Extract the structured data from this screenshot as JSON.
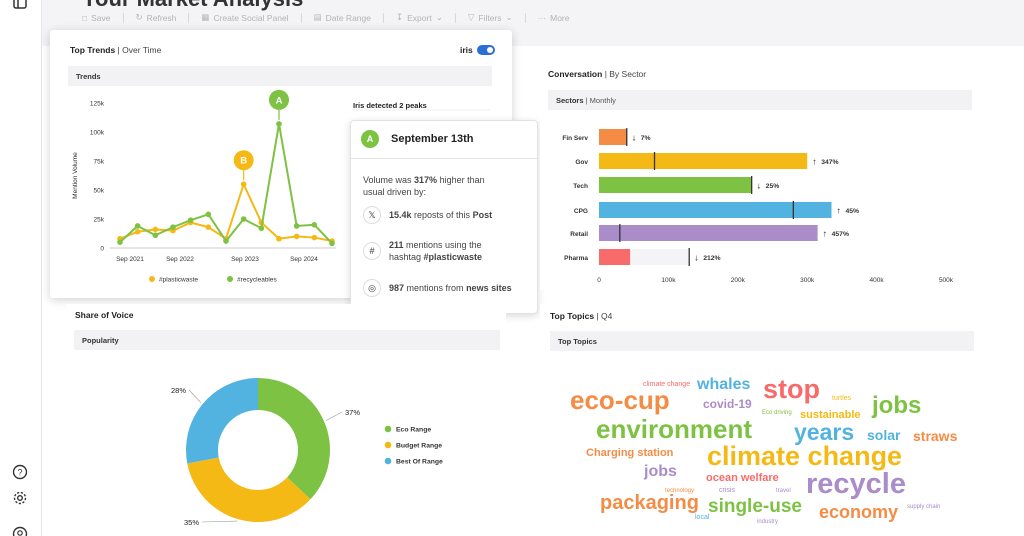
{
  "page": {
    "title": "Your Market Analysis"
  },
  "toolbar": {
    "items": [
      "Save",
      "Refresh",
      "Create Social Panel",
      "Date Range",
      "Export",
      "Filters",
      "More"
    ]
  },
  "trends": {
    "title": "Top Trends",
    "subtitle": "Over Time",
    "iris_label": "iris",
    "iris_on": true,
    "subbar": "Trends",
    "peaks_note": "Iris detected 2 peaks",
    "chart_data": {
      "type": "line",
      "ylabel": "Mention Volume",
      "yticks": [
        "0",
        "25k",
        "50k",
        "75k",
        "100k",
        "125k"
      ],
      "xticks": [
        "Sep 2021",
        "Sep 2022",
        "Sep 2023",
        "Sep 2024"
      ],
      "ylim": [
        0,
        125000
      ],
      "series": [
        {
          "name": "#plasticwaste",
          "color": "#f5b916",
          "values": [
            8000,
            14000,
            16000,
            15000,
            22000,
            18000,
            8000,
            55000,
            22000,
            8000,
            10000,
            9000,
            6000
          ]
        },
        {
          "name": "#recycleables",
          "color": "#7dc242",
          "values": [
            5000,
            19000,
            11000,
            18000,
            24000,
            29000,
            6000,
            25000,
            17000,
            107000,
            19000,
            20000,
            4000
          ]
        }
      ],
      "peaks": [
        {
          "label": "A",
          "color": "#7dc242"
        },
        {
          "label": "B",
          "color": "#f5b916"
        }
      ]
    }
  },
  "tooltip": {
    "badge": "A",
    "date": "September 13th",
    "line1_pre": "Volume was ",
    "line1_bold": "317%",
    "line1_post": " higher than",
    "line2": "usual driven by:",
    "r1_bold": "15.4k",
    "r1_mid": " reposts of this ",
    "r1_bold2": "Post",
    "r2_bold": "211",
    "r2_mid": " mentions using the",
    "r2_line2_pre": "hashtag ",
    "r2_bold2": "#plasticwaste",
    "r3_bold": "987",
    "r3_mid": " mentions from ",
    "r3_bold2": "news sites",
    "icons": {
      "x": "x-logo-icon",
      "hash": "hashtag-icon",
      "globe": "globe-icon"
    }
  },
  "conversation": {
    "title": "Conversation",
    "subtitle": "By Sector",
    "subbar": "Sectors",
    "subbar_sub": "Monthly",
    "chart_data": {
      "type": "bar",
      "orientation": "horizontal",
      "categories": [
        "Fin Serv",
        "Gov",
        "Tech",
        "CPG",
        "Retail",
        "Pharma"
      ],
      "values": [
        40000,
        300000,
        220000,
        335000,
        315000,
        45000
      ],
      "markers": [
        40000,
        80000,
        220000,
        280000,
        30000,
        130000
      ],
      "bar_colors": [
        "#f58c45",
        "#f5b916",
        "#7dc242",
        "#52b3e0",
        "#a98cc8",
        "#f86b6b"
      ],
      "changes": [
        {
          "dir": "down",
          "text": "7%"
        },
        {
          "dir": "up",
          "text": "347%"
        },
        {
          "dir": "down",
          "text": "25%"
        },
        {
          "dir": "up",
          "text": "45%"
        },
        {
          "dir": "up",
          "text": "457%"
        },
        {
          "dir": "down",
          "text": "212%"
        }
      ],
      "xticks": [
        "0",
        "100k",
        "200k",
        "300k",
        "400k",
        "500k"
      ],
      "xlim": [
        0,
        500000
      ]
    }
  },
  "sov": {
    "title": "Share of Voice",
    "subbar": "Popularity",
    "chart_data": {
      "type": "pie",
      "labels": [
        "Eco Range",
        "Budget Range",
        "Best Of Range"
      ],
      "values": [
        37,
        35,
        28
      ],
      "value_labels": [
        "37%",
        "35%",
        "28%"
      ],
      "colors": [
        "#7dc242",
        "#f5b916",
        "#52b3e0"
      ]
    }
  },
  "topics": {
    "title": "Top Topics",
    "subtitle": "Q4",
    "subbar": "Top Topics",
    "words": [
      {
        "text": "climate change",
        "color": "#f86b6b"
      },
      {
        "text": "whales",
        "color": "#52b3e0"
      },
      {
        "text": "stop",
        "color": "#f86b6b"
      },
      {
        "text": "turtles",
        "color": "#f5b916"
      },
      {
        "text": "eco-cup",
        "color": "#f58c45"
      },
      {
        "text": "covid-19",
        "color": "#a98cc8"
      },
      {
        "text": "Eco driving",
        "color": "#7dc242"
      },
      {
        "text": "sustainable",
        "color": "#f5b916"
      },
      {
        "text": "jobs",
        "color": "#7dc242"
      },
      {
        "text": "environment",
        "color": "#7dc242"
      },
      {
        "text": "years",
        "color": "#52b3e0"
      },
      {
        "text": "solar",
        "color": "#52b3e0"
      },
      {
        "text": "straws",
        "color": "#f58c45"
      },
      {
        "text": "Charging station",
        "color": "#f58c45"
      },
      {
        "text": "climate change",
        "color": "#f5b916"
      },
      {
        "text": "jobs",
        "color": "#a98cc8"
      },
      {
        "text": "ocean welfare",
        "color": "#f86b6b"
      },
      {
        "text": "recycle",
        "color": "#a98cc8"
      },
      {
        "text": "technology",
        "color": "#f58c45"
      },
      {
        "text": "crisis",
        "color": "#a98cc8"
      },
      {
        "text": "travel",
        "color": "#a98cc8"
      },
      {
        "text": "packaging",
        "color": "#f58c45"
      },
      {
        "text": "single-use",
        "color": "#7dc242"
      },
      {
        "text": "economy",
        "color": "#f58c45"
      },
      {
        "text": "supply chain",
        "color": "#a98cc8"
      },
      {
        "text": "local",
        "color": "#52b3e0"
      },
      {
        "text": "industry",
        "color": "#a98cc8"
      }
    ]
  }
}
